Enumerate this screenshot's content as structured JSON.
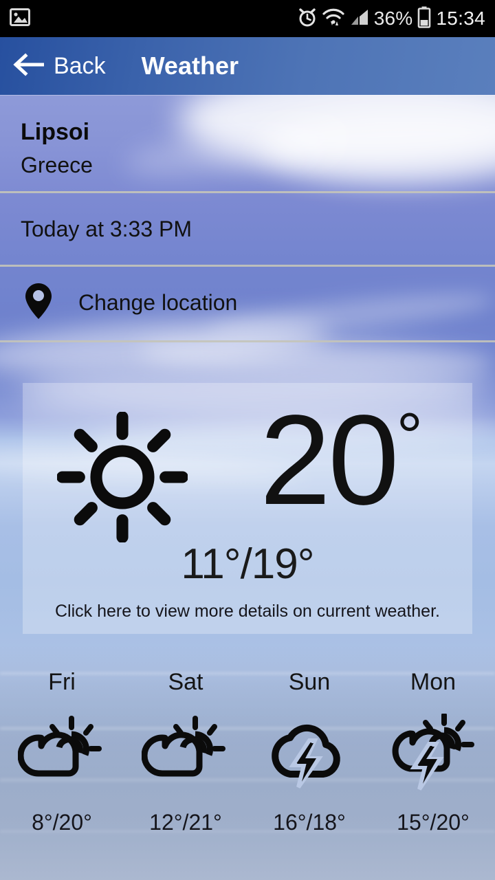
{
  "statusbar": {
    "icons_left": [
      "image-icon"
    ],
    "icons_right": [
      "alarm-clock-icon",
      "wifi-icon",
      "signal-bars-icon",
      "battery-icon"
    ],
    "battery_percent": "36%",
    "clock": "15:34"
  },
  "header": {
    "back_label": "Back",
    "title": "Weather",
    "back_icon": "arrow-left-icon"
  },
  "location": {
    "city": "Lipsoi",
    "country": "Greece"
  },
  "observation": {
    "time_text": "Today at 3:33 PM"
  },
  "change_location": {
    "label": "Change location",
    "icon": "map-pin-icon"
  },
  "current": {
    "condition_icon": "sun-clear-icon",
    "temperature": "20",
    "degree": "°",
    "low_high": "11°/19°",
    "hint": "Click here to view more details on current weather."
  },
  "forecast": [
    {
      "day": "Fri",
      "icon": "sun-behind-cloud-icon",
      "low_high": "8°/20°"
    },
    {
      "day": "Sat",
      "icon": "sun-behind-cloud-icon",
      "low_high": "12°/21°"
    },
    {
      "day": "Sun",
      "icon": "cloud-lightning-icon",
      "low_high": "16°/18°"
    },
    {
      "day": "Mon",
      "icon": "sun-cloud-lightning-icon",
      "low_high": "15°/20°"
    }
  ],
  "colors": {
    "statusbar_bg": "#000000",
    "header_gradient_start": "#27509f",
    "header_gradient_end": "#5a7fbd",
    "header_text": "#ffffff",
    "divider": "#c4c4b9",
    "body_text": "#111111",
    "card_overlay": "rgba(255,255,255,0.28)"
  }
}
